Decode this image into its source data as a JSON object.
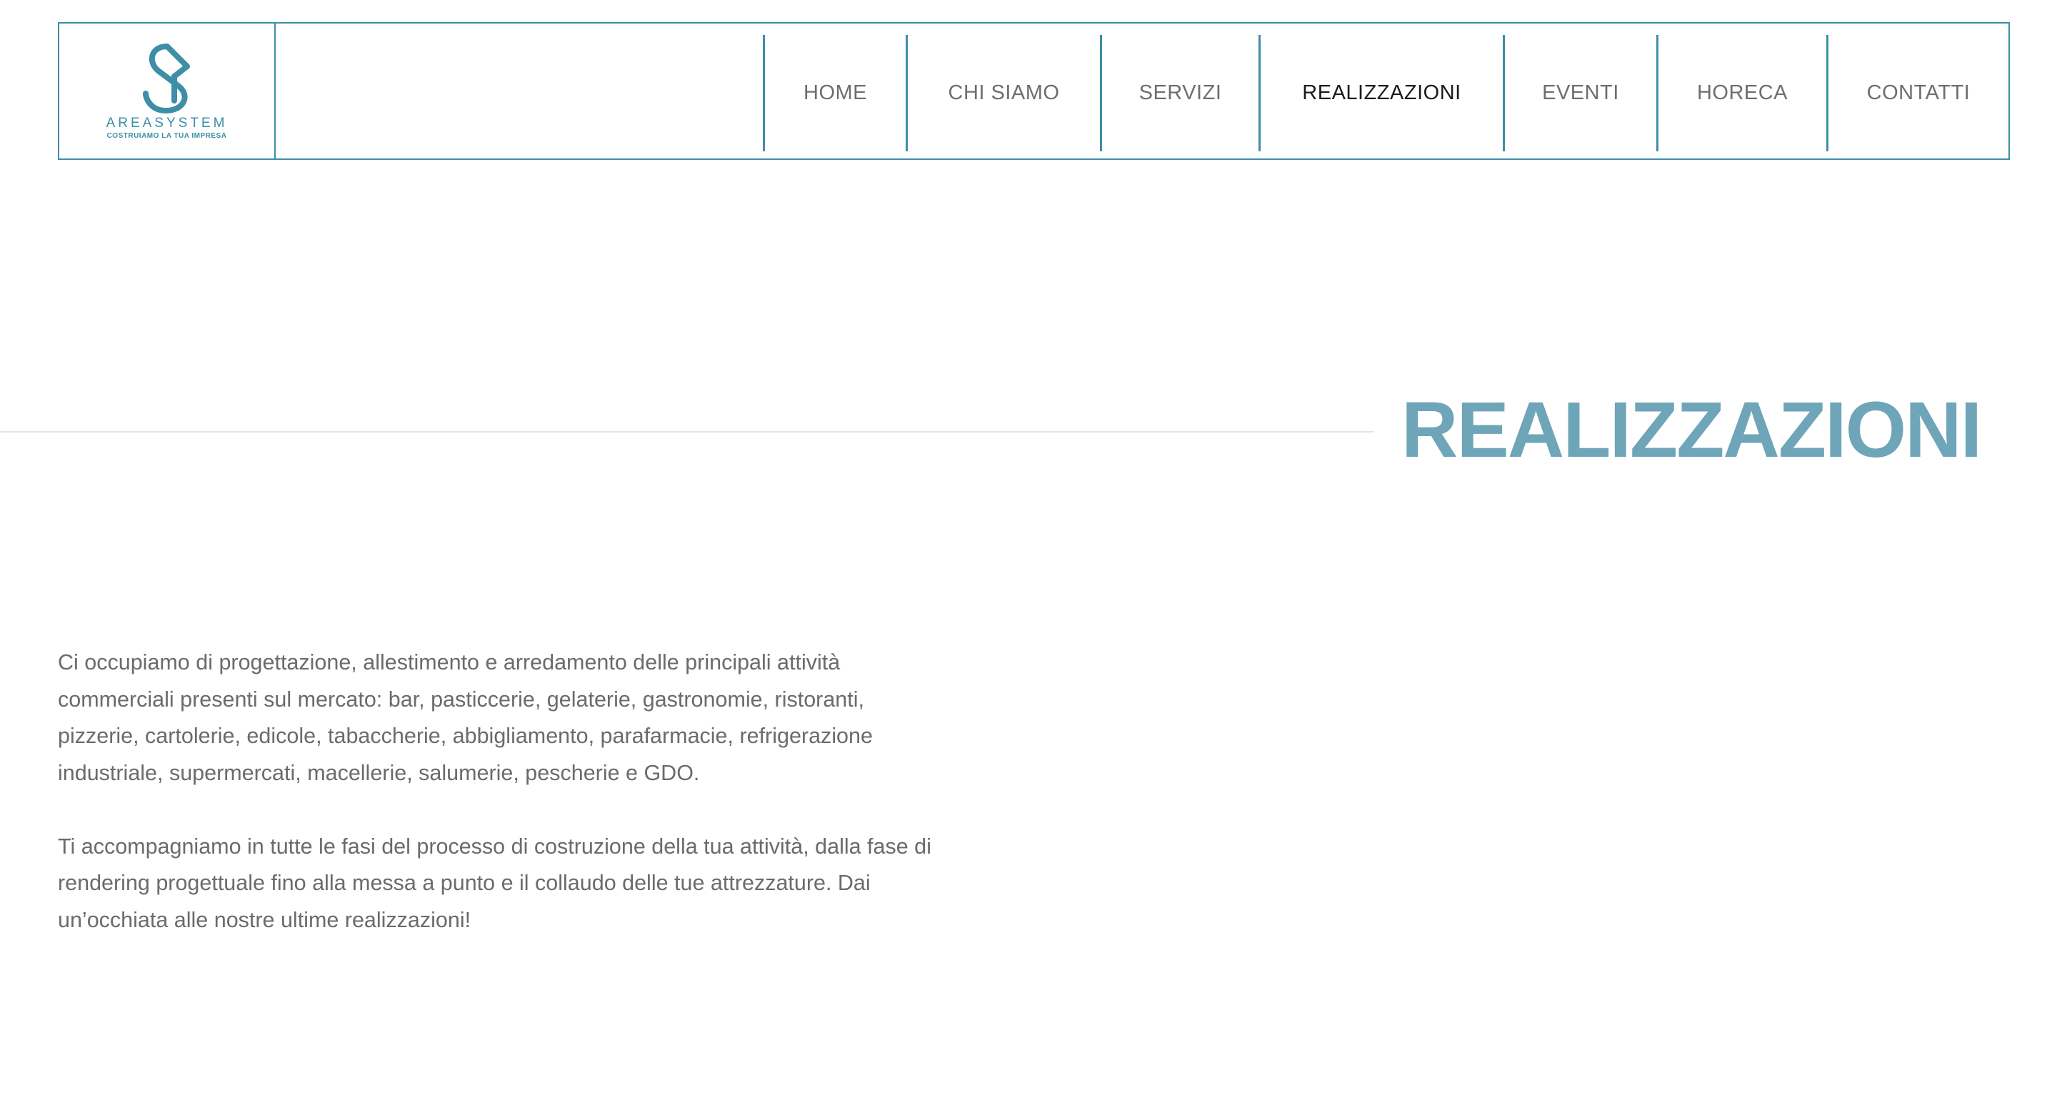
{
  "brand": {
    "name": "AREASYSTEM",
    "tagline": "COSTRUIAMO LA TUA IMPRESA",
    "logo_icon": "sa-monogram-icon",
    "accent_color": "#3d8ea7"
  },
  "nav": {
    "items": [
      {
        "label": "HOME",
        "active": false
      },
      {
        "label": "CHI SIAMO",
        "active": false
      },
      {
        "label": "SERVIZI",
        "active": false
      },
      {
        "label": "REALIZZAZIONI",
        "active": true
      },
      {
        "label": "EVENTI",
        "active": false
      },
      {
        "label": "HORECA",
        "active": false
      },
      {
        "label": "CONTATTI",
        "active": false
      }
    ]
  },
  "hero": {
    "title": "REALIZZAZIONI",
    "title_color": "#6fa5b8"
  },
  "intro": {
    "paragraph_1": "Ci occupiamo di progettazione, allestimento e arredamento delle principali attività commerciali presenti sul mercato: bar, pasticcerie, gelaterie, gastronomie, ristoranti, pizzerie, cartolerie, edicole, tabaccherie, abbigliamento, parafarmacie, refrigerazione industriale, supermercati, macellerie, salumerie, pescherie e GDO.",
    "paragraph_2": "Ti accompagniamo in tutte le fasi del processo di costruzione della tua attività, dalla fase di rendering progettuale fino alla messa a punto e il collaudo delle tue attrezzature. Dai un’occhiata alle nostre ultime realizzazioni!"
  }
}
